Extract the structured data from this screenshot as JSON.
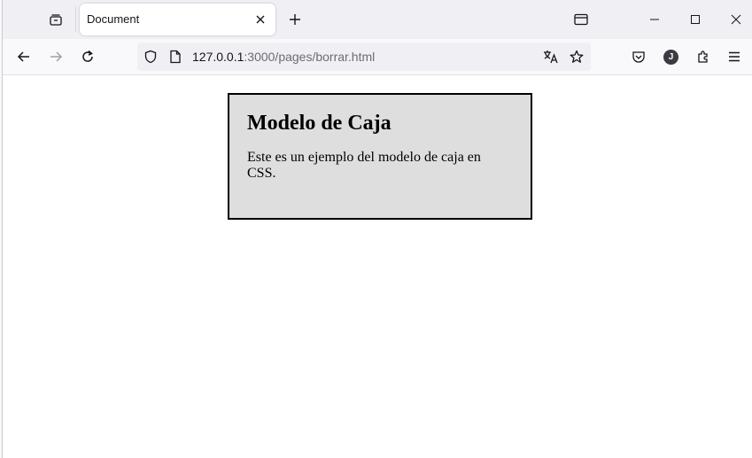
{
  "browser": {
    "tab": {
      "title": "Document"
    },
    "url": {
      "host": "127.0.0.1",
      "rest": ":3000/pages/borrar.html"
    },
    "profile_initial": "J"
  },
  "icons": {
    "tab_manager": "tab-manager-icon",
    "close_tab": "close-icon",
    "new_tab": "plus-icon",
    "sidebar": "window-icon",
    "minimize": "minimize-icon",
    "maximize": "maximize-icon",
    "close_window": "close-icon",
    "back": "arrow-left-icon",
    "forward": "arrow-right-icon",
    "reload": "reload-icon",
    "shield": "shield-icon",
    "page": "page-icon",
    "translate": "translate-icon",
    "bookmark": "star-icon",
    "pocket": "pocket-icon",
    "extensions": "puzzle-icon",
    "menu": "hamburger-icon"
  },
  "page": {
    "heading": "Modelo de Caja",
    "paragraph": "Este es un ejemplo del modelo de caja en CSS."
  },
  "colors": {
    "box_background": "#dedede",
    "box_border": "#000000",
    "chrome_background": "#f0f0f4"
  }
}
